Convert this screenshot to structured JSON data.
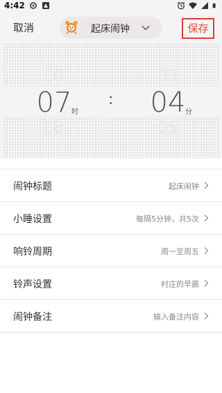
{
  "status_bar": {
    "time": "4:42",
    "left_icons": [
      "clock-badge-icon",
      "app-notification-icon"
    ],
    "right_icons": [
      "alarm-icon",
      "wifi-icon",
      "signal-icon",
      "battery-icon"
    ]
  },
  "header": {
    "cancel_label": "取消",
    "title": "起床闹钟",
    "save_label": "保存",
    "accent_color": "#e84a3a"
  },
  "picker": {
    "hour": {
      "prev": "06",
      "current": "07",
      "next": "08",
      "unit": "时"
    },
    "minute": {
      "prev": "03",
      "current": "04",
      "next": "05",
      "unit": "分"
    },
    "separator": ":"
  },
  "settings": [
    {
      "label": "闹钟标题",
      "value": "起床闹钟"
    },
    {
      "label": "小睡设置",
      "value": "每隔5分钟，共5次"
    },
    {
      "label": "响铃周期",
      "value": "周一至周五"
    },
    {
      "label": "铃声设置",
      "value": "村庄的早晨"
    },
    {
      "label": "闹钟备注",
      "value": "输入备注内容"
    }
  ]
}
